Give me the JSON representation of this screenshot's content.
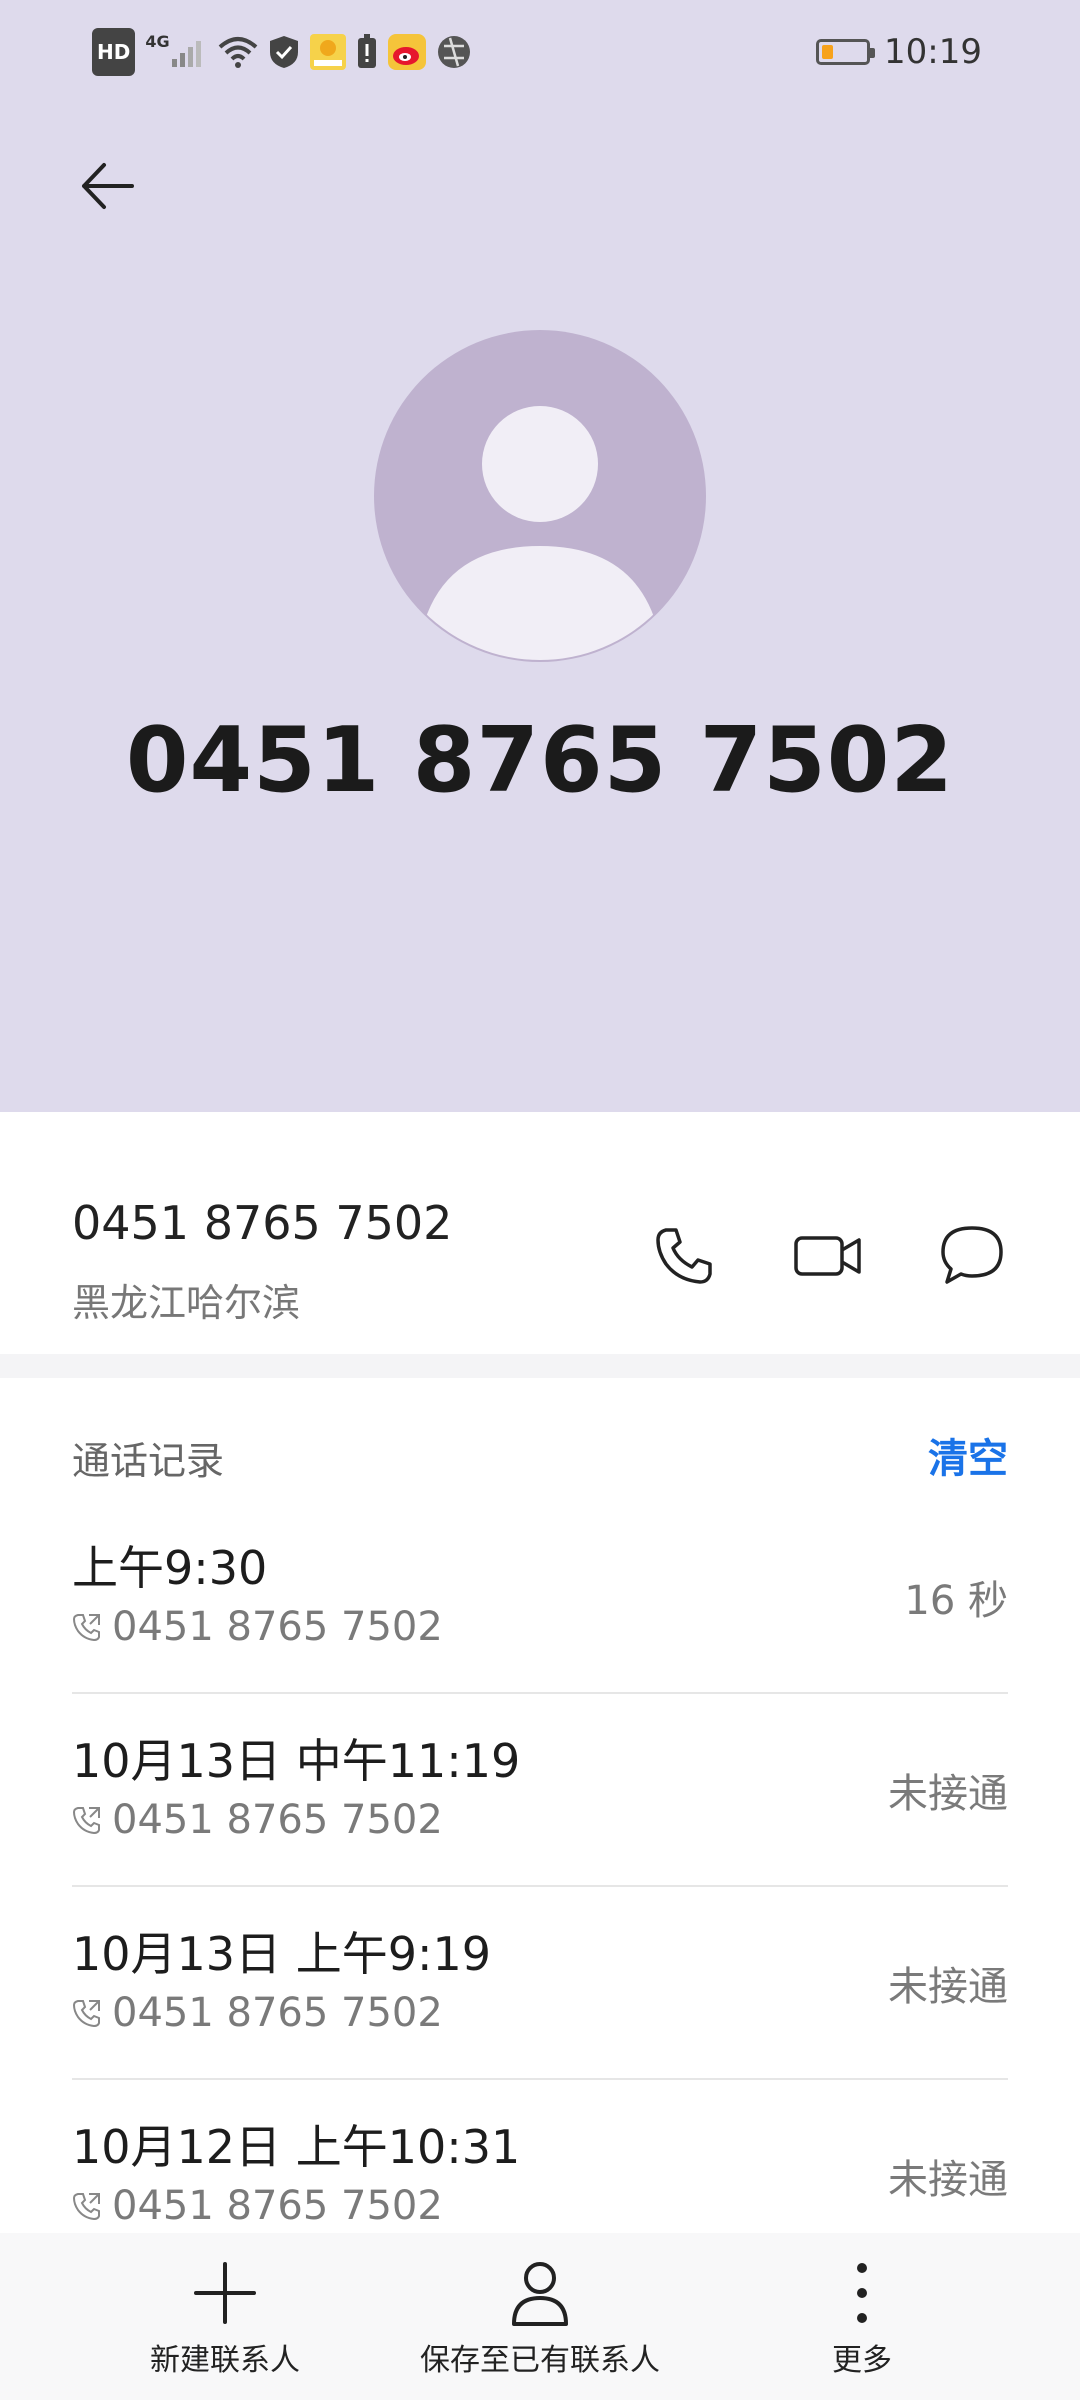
{
  "status_bar": {
    "left_icons": [
      "hd-badge",
      "4g-signal-icon",
      "wifi-icon",
      "shield-icon",
      "app-notification-icon",
      "alert-icon",
      "weibo-icon",
      "vpn-icon"
    ],
    "hd_label": "HD",
    "network_label": "4G",
    "battery_level": 0.25,
    "time": "10:19"
  },
  "header": {
    "phone_number": "0451 8765 7502",
    "colors": {
      "background": "#dedaec",
      "avatar_bg": "#bfb2cf",
      "avatar_fg": "#f1eef6"
    }
  },
  "info": {
    "number": "0451 8765 7502",
    "location": "黑龙江哈尔滨"
  },
  "call_log": {
    "title": "通话记录",
    "clear_label": "清空",
    "rows": [
      {
        "date": "上午9:30",
        "number": "0451 8765 7502",
        "status": "16 秒"
      },
      {
        "date": "10月13日 中午11:19",
        "number": "0451 8765 7502",
        "status": "未接通"
      },
      {
        "date": "10月13日 上午9:19",
        "number": "0451 8765 7502",
        "status": "未接通"
      },
      {
        "date": "10月12日 上午10:31",
        "number": "0451 8765 7502",
        "status": "未接通"
      }
    ]
  },
  "bottom_bar": {
    "new_contact": "新建联系人",
    "save_existing": "保存至已有联系人",
    "more": "更多"
  }
}
